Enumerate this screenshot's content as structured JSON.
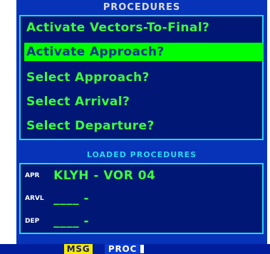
{
  "screen": {
    "title": "PROCEDURES",
    "procedures": [
      "Activate Vectors-To-Final?",
      "Activate Approach?",
      "Select Approach?",
      "Select Arrival?",
      "Select Departure?"
    ],
    "selected_index": 1,
    "loaded_title": "LOADED PROCEDURES",
    "loaded_procedures": [
      {
        "label": "APR",
        "value": "KLYH - VOR 04"
      },
      {
        "label": "ARVL",
        "value": "____ -"
      },
      {
        "label": "DEP",
        "value": "____ -"
      }
    ]
  },
  "softkeys": {
    "msg": "MSG",
    "proc": "PROC"
  },
  "colors": {
    "background": "#0633B8",
    "panel": "#001775",
    "border": "#23D8E8",
    "text_green": "#3CFF3C",
    "selection": "#00FF00",
    "msg_key": "#F3EA00"
  }
}
